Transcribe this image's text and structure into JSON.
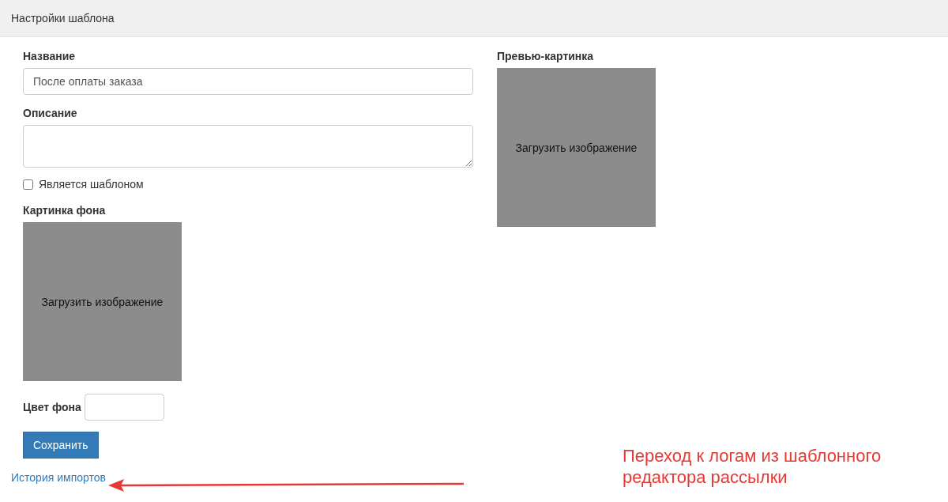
{
  "header": {
    "title": "Настройки шаблона"
  },
  "form": {
    "name": {
      "label": "Название",
      "value": "После оплаты заказа"
    },
    "description": {
      "label": "Описание"
    },
    "is_template": {
      "label": "Является шаблоном",
      "checked": false
    },
    "background_image": {
      "label": "Картинка фона",
      "upload": "Загрузить изображение"
    },
    "background_color": {
      "label": "Цвет фона"
    },
    "save_button": "Сохранить"
  },
  "preview_image": {
    "label": "Превью-картинка",
    "upload": "Загрузить изображение"
  },
  "import_history_link": "История импортов",
  "annotation": {
    "lines": [
      "Переход к логам из шаблонного",
      "редактора рассылки"
    ]
  }
}
